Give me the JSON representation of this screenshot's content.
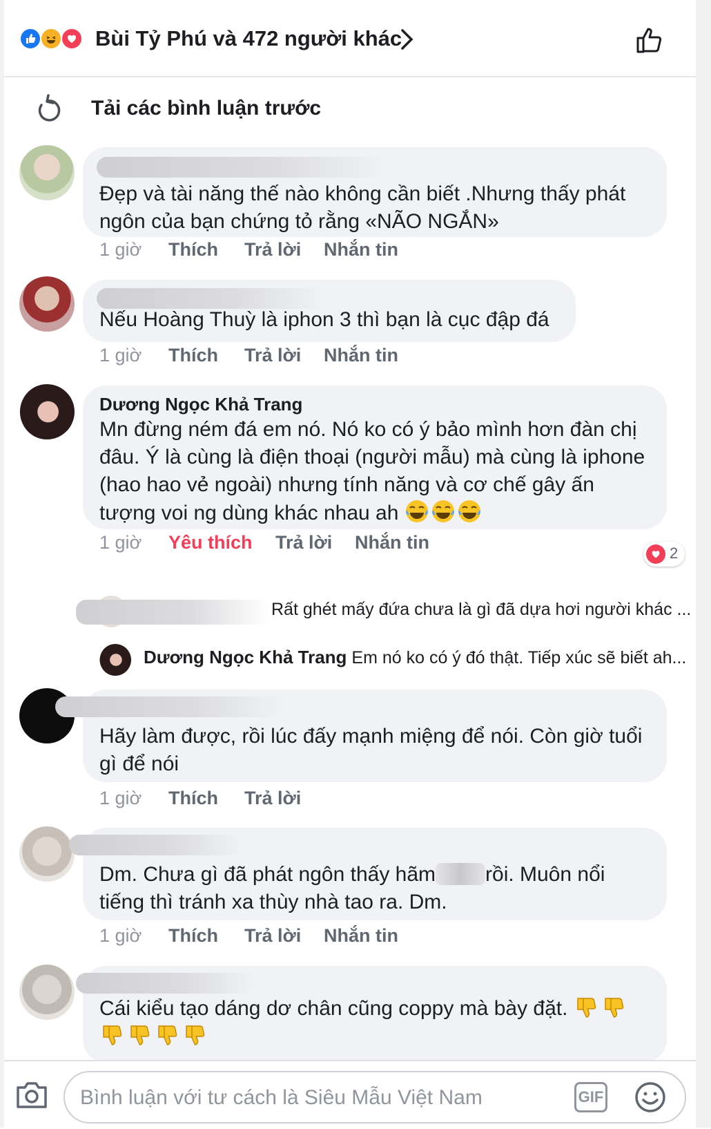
{
  "header": {
    "title": "Bùi Tỷ Phú và 472 người khác",
    "reaction_icons": [
      "like-icon",
      "haha-icon",
      "love-icon"
    ]
  },
  "load_previous": {
    "label": "Tải các bình luận trước"
  },
  "comments": [
    {
      "author": "",
      "text": "Đẹp và tài năng thế nào không cần biết .Nhưng thấy phát ngôn của bạn chứng tỏ rằng «NÃO NGẮN»",
      "time": "1 giờ",
      "like": "Thích",
      "reply": "Trả lời",
      "message": "Nhắn tin"
    },
    {
      "author": "",
      "text": "Nếu Hoàng Thuỳ là iphon 3 thì bạn là cục đập đá",
      "time": "1 giờ",
      "like": "Thích",
      "reply": "Trả lời",
      "message": "Nhắn tin"
    },
    {
      "author": "Dương Ngọc Khả Trang",
      "text": "Mn đừng ném đá em nó. Nó ko có ý bảo mình hơn đàn chị đâu. Ý là cùng là điện thoại (người mẫu) mà cùng là iphone (hao hao vẻ ngoài) nhưng tính năng và cơ chế gây ấn tượng voi ng dùng khác nhau ah",
      "time": "1 giờ",
      "like": "Yêu thích",
      "reply": "Trả lời",
      "message": "Nhắn tin",
      "reaction_count": "2"
    },
    {
      "author": "",
      "text": "Hãy làm được, rồi lúc đấy mạnh miệng để nói. Còn giờ tuổi gì để nói",
      "time": "1 giờ",
      "like": "Thích",
      "reply": "Trả lời"
    },
    {
      "author": "",
      "text": "Dm. Chưa gì đã phát ngôn thấy hãm",
      "text_after": "rồi. Muôn nổi tiếng thì tránh xa thùy nhà tao ra. Dm.",
      "time": "1 giờ",
      "like": "Thích",
      "reply": "Trả lời",
      "message": "Nhắn tin"
    },
    {
      "author": "",
      "text": "Cái kiểu tạo dáng dơ chân cũng coppy mà bày đặt."
    }
  ],
  "replies": [
    {
      "author": "",
      "text": "Rất ghét mấy đứa chưa là gì đã dựa hơi người khác ..."
    },
    {
      "author": "Dương Ngọc Khả Trang",
      "text": "Em nó ko có ý đó thật. Tiếp xúc sẽ biết ah..."
    }
  ],
  "composer": {
    "placeholder": "Bình luận với tư cách là Siêu Mẫu Việt Nam",
    "gif_label": "GIF"
  },
  "colors": {
    "accent_love": "#f33e58",
    "like_blue": "#1877f2",
    "bubble": "#f0f2f5"
  }
}
